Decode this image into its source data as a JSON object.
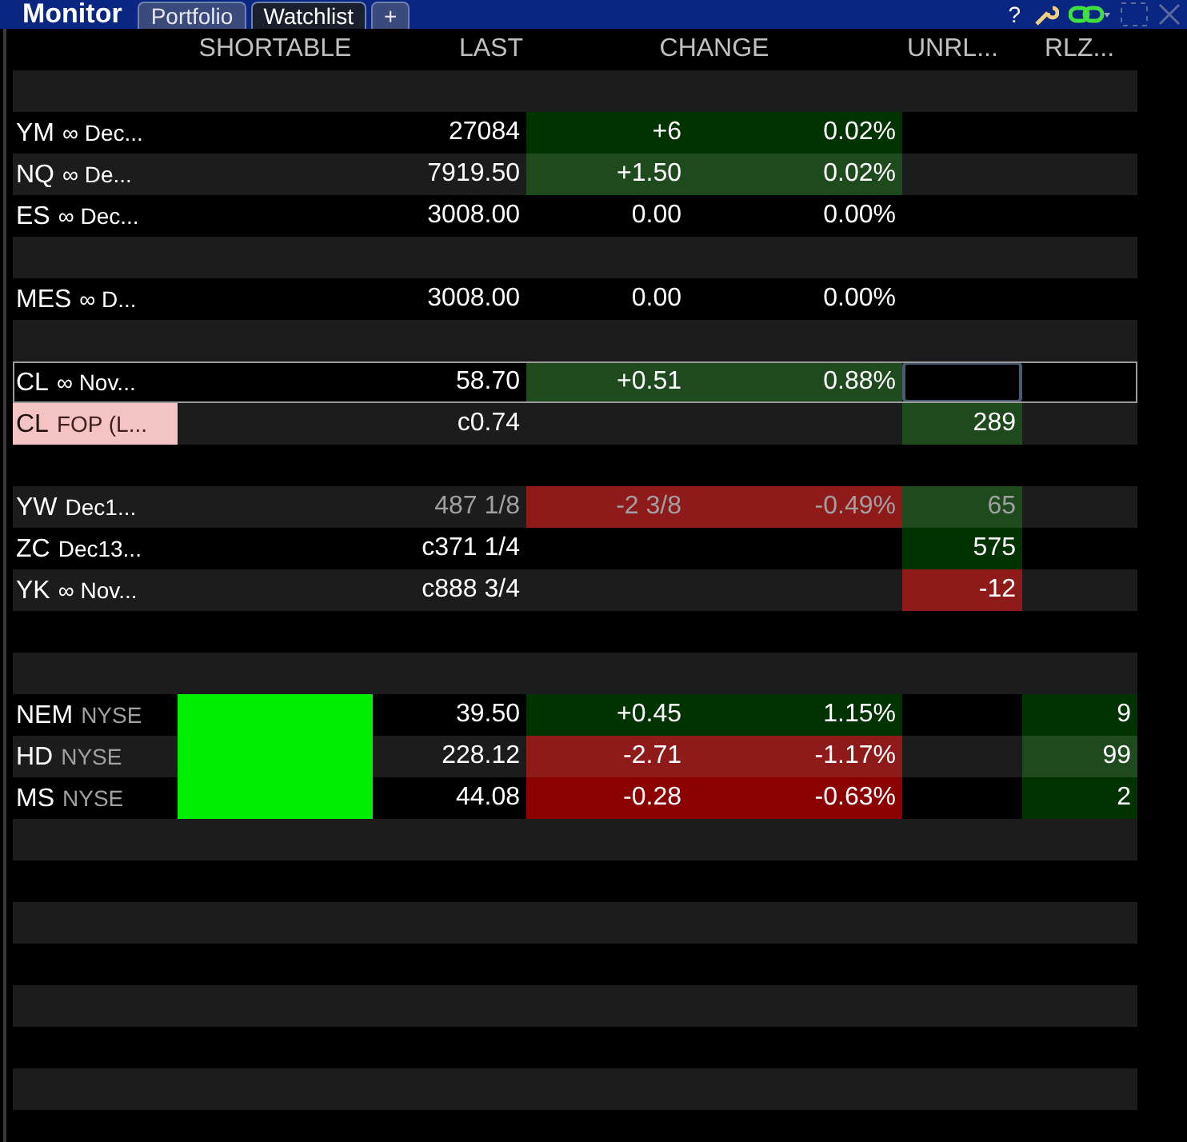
{
  "window": {
    "title": "Monitor"
  },
  "tabs": [
    {
      "label": "Portfolio",
      "selected": false
    },
    {
      "label": "Watchlist",
      "selected": true
    },
    {
      "label": "+",
      "selected": false
    }
  ],
  "toolbar": {
    "help": "?"
  },
  "columns": {
    "shortable": "SHORTABLE",
    "last": "LAST",
    "change": "CHANGE",
    "unrealized": "UNRL...",
    "realized": "RLZ..."
  },
  "rows": [
    {
      "kind": "blank"
    },
    {
      "kind": "instrument",
      "symbol": {
        "text": "YM"
      },
      "detail": "∞ Dec...",
      "last": "27084",
      "change": {
        "text": "+6",
        "color": "#003300"
      },
      "change_pct": {
        "text": "0.02%",
        "color": "#003300"
      },
      "selected": false
    },
    {
      "kind": "instrument",
      "symbol": {
        "text": "NQ"
      },
      "detail": "∞ De...",
      "last": "7919.50",
      "change": {
        "text": "+1.50",
        "color": "#1e4a1e"
      },
      "change_pct": {
        "text": "0.02%",
        "color": "#1e4a1e"
      },
      "selected": false
    },
    {
      "kind": "instrument",
      "symbol": {
        "text": "ES"
      },
      "detail": "∞ Dec...",
      "last": "3008.00",
      "change": {
        "text": "0.00"
      },
      "change_pct": {
        "text": "0.00%"
      },
      "selected": false
    },
    {
      "kind": "blank"
    },
    {
      "kind": "instrument",
      "symbol": {
        "text": "MES"
      },
      "detail": "∞ D...",
      "last": "3008.00",
      "change": {
        "text": "0.00"
      },
      "change_pct": {
        "text": "0.00%"
      },
      "selected": false
    },
    {
      "kind": "blank"
    },
    {
      "kind": "instrument",
      "symbol": {
        "text": "CL"
      },
      "detail": "∞ Nov...",
      "last": "58.70",
      "change": {
        "text": "+0.51",
        "color": "#1e4a1e"
      },
      "change_pct": {
        "text": "0.88%",
        "color": "#1e4a1e"
      },
      "unrealized": {
        "focused": true
      },
      "selected": true
    },
    {
      "kind": "instrument",
      "symbol": {
        "text": "CL",
        "color": "#f4c4c4"
      },
      "detail": "FOP (L...",
      "last": "c0.74",
      "unrealized": {
        "text": "289",
        "color": "#1e4a1e"
      },
      "selected": false
    },
    {
      "kind": "blank"
    },
    {
      "kind": "instrument",
      "symbol": {
        "text": "YW"
      },
      "detail": "Dec1...",
      "stale": true,
      "last": "487 1/8",
      "change": {
        "text": "-2 3/8",
        "color": "#8f1a1a"
      },
      "change_pct": {
        "text": "-0.49%",
        "color": "#8f1a1a"
      },
      "unrealized": {
        "text": "65",
        "color": "#1e4a1e"
      },
      "selected": false
    },
    {
      "kind": "instrument",
      "symbol": {
        "text": "ZC"
      },
      "detail": "Dec13...",
      "last": "c371 1/4",
      "unrealized": {
        "text": "575",
        "color": "#003300"
      },
      "selected": false
    },
    {
      "kind": "instrument",
      "symbol": {
        "text": "YK"
      },
      "detail": "∞ Nov...",
      "last": "c888 3/4",
      "unrealized": {
        "text": "-12",
        "color": "#8f1a1a"
      },
      "selected": false
    },
    {
      "kind": "blank"
    },
    {
      "kind": "blank"
    },
    {
      "kind": "instrument",
      "symbol": {
        "text": "NEM"
      },
      "detail": "NYSE",
      "detail_muted": true,
      "shortable": {
        "color": "#00ee00"
      },
      "last": "39.50",
      "change": {
        "text": "+0.45",
        "color": "#003300"
      },
      "change_pct": {
        "text": "1.15%",
        "color": "#003300"
      },
      "realized": {
        "text": "9",
        "color": "#003300"
      },
      "selected": false
    },
    {
      "kind": "instrument",
      "symbol": {
        "text": "HD"
      },
      "detail": "NYSE",
      "detail_muted": true,
      "shortable": {
        "color": "#00ee00"
      },
      "last": "228.12",
      "change": {
        "text": "-2.71",
        "color": "#8f1a1a"
      },
      "change_pct": {
        "text": "-1.17%",
        "color": "#8f1a1a"
      },
      "realized": {
        "text": "99",
        "color": "#1e4a1e"
      },
      "selected": false
    },
    {
      "kind": "instrument",
      "symbol": {
        "text": "MS"
      },
      "detail": "NYSE",
      "detail_muted": true,
      "shortable": {
        "color": "#00ee00"
      },
      "last": "44.08",
      "change": {
        "text": "-0.28",
        "color": "#8b0000"
      },
      "change_pct": {
        "text": "-0.63%",
        "color": "#8b0000"
      },
      "realized": {
        "text": "2",
        "color": "#003300"
      },
      "selected": false
    },
    {
      "kind": "blank"
    },
    {
      "kind": "blank"
    },
    {
      "kind": "blank"
    },
    {
      "kind": "blank"
    },
    {
      "kind": "blank"
    },
    {
      "kind": "blank"
    },
    {
      "kind": "blank"
    }
  ]
}
